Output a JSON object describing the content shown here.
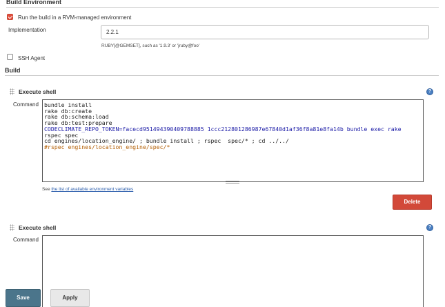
{
  "build_environment": {
    "title": "Build Environment",
    "rvm_checkbox": {
      "label": "Run the build in a RVM-managed environment",
      "checked": true
    },
    "implementation": {
      "label": "Implementation",
      "value": "2.2.1",
      "hint": "RUBY[@GEMSET], such as '1.9.3' or 'jruby@foo'"
    },
    "ssh_agent": {
      "label": "SSH Agent",
      "checked": false
    }
  },
  "build": {
    "title": "Build",
    "steps": [
      {
        "title": "Execute shell",
        "command_label": "Command",
        "command_lines": [
          "bundle install",
          "rake db:create",
          "rake db:schema:load",
          "rake db:test:prepare",
          "CODECLIMATE_REPO_TOKEN=facecd951494390409788885 1ccc212801286987e67840d1af36f8a81e8fa14b bundle exec rake",
          "rspec spec",
          "cd engines/location_engine/ ; bundle install ; rspec  spec/* ; cd ../../",
          "#rspec engines/location_engine/spec/*"
        ],
        "env_hint_prefix": "See ",
        "env_hint_link": "the list of available environment variables",
        "delete_label": "Delete",
        "help_icon": "help-icon"
      },
      {
        "title": "Execute shell",
        "command_label": "Command",
        "command_lines": [],
        "help_icon": "help-icon"
      }
    ]
  },
  "footer": {
    "save_label": "Save",
    "apply_label": "Apply"
  },
  "colors": {
    "accent_checkbox": "#e2503f",
    "delete_button": "#d24939",
    "save_button": "#4b758b",
    "help_icon": "#4a7fc1",
    "link": "#2a5cab"
  }
}
